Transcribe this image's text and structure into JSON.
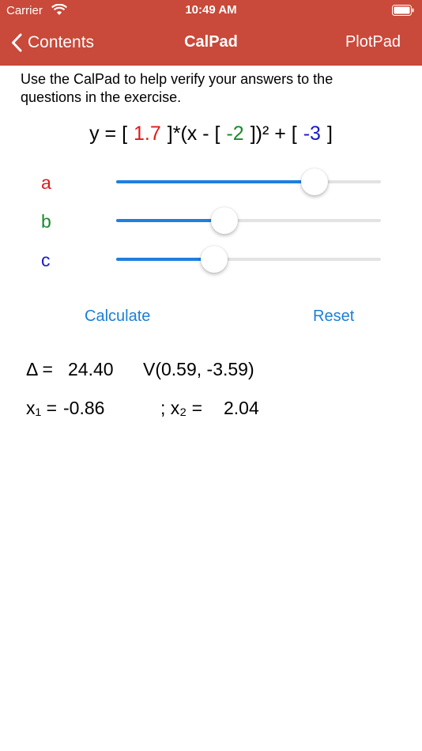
{
  "status_bar": {
    "carrier": "Carrier",
    "time": "10:49 AM"
  },
  "nav": {
    "back_label": "Contents",
    "title": "CalPad",
    "right_label": "PlotPad"
  },
  "intro_text": "Use the CalPad to help verify your answers to the questions in the exercise.",
  "equation": {
    "prefix": "y = [",
    "a": "1.7",
    "mid1": "]*(x - [",
    "b": "-2",
    "mid2": "])² + [",
    "c": "-3",
    "suffix": "]"
  },
  "sliders": [
    {
      "label": "a",
      "fraction": 0.75,
      "color": "#e01919"
    },
    {
      "label": "b",
      "fraction": 0.41,
      "color": "#1a8a2c"
    },
    {
      "label": "c",
      "fraction": 0.37,
      "color": "#1a1acf"
    }
  ],
  "buttons": {
    "calculate": "Calculate",
    "reset": "Reset"
  },
  "results": {
    "delta_label": "Δ =",
    "delta_value": "24.40",
    "vertex_open": "V(",
    "vertex_x": "0.59",
    "vertex_sep": ",",
    "vertex_y": "-3.59",
    "vertex_close": ")",
    "x1_label": "x₁ =",
    "x1_value": "-0.86",
    "x2_label": "; x₂ =",
    "x2_value": "2.04"
  },
  "colors": {
    "header": "#c9493a",
    "accent": "#1f7fe0",
    "a": "#e01919",
    "b": "#1a8a2c",
    "c": "#1a1acf"
  }
}
